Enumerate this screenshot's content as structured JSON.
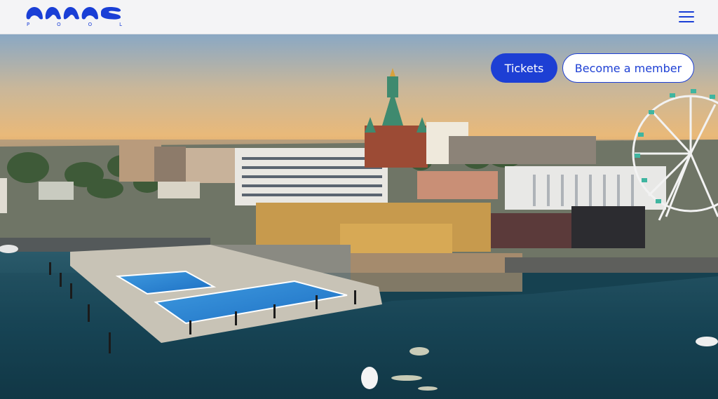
{
  "brand": {
    "logo_text": "ALLAS",
    "sub_letters": [
      "P",
      "O",
      "O",
      "L"
    ],
    "color": "#1a3fd6"
  },
  "header": {
    "menu_icon": "hamburger-menu-icon"
  },
  "hero": {
    "tickets_label": "Tickets",
    "member_label": "Become a member",
    "accent": "#1d3fd4"
  }
}
